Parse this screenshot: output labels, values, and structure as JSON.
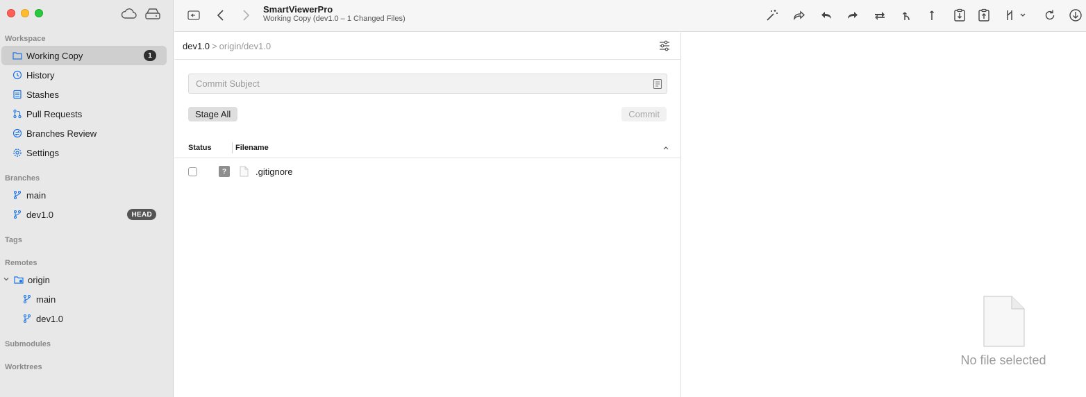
{
  "window": {
    "title": "SmartViewerPro",
    "subtitle": "Working Copy (dev1.0 – 1 Changed Files)"
  },
  "sidebar": {
    "workspace_title": "Workspace",
    "workspace_items": [
      {
        "label": "Working Copy",
        "icon": "folder-icon",
        "badge": "1",
        "selected": true
      },
      {
        "label": "History",
        "icon": "history-icon"
      },
      {
        "label": "Stashes",
        "icon": "stash-icon"
      },
      {
        "label": "Pull Requests",
        "icon": "pull-request-icon"
      },
      {
        "label": "Branches Review",
        "icon": "branches-review-icon"
      },
      {
        "label": "Settings",
        "icon": "gear-icon"
      }
    ],
    "branches_title": "Branches",
    "branches": [
      {
        "label": "main"
      },
      {
        "label": "dev1.0",
        "badge": "HEAD"
      }
    ],
    "tags_title": "Tags",
    "remotes_title": "Remotes",
    "remote": {
      "label": "origin",
      "branches": [
        "main",
        "dev1.0"
      ]
    },
    "submodules_title": "Submodules",
    "worktrees_title": "Worktrees"
  },
  "main": {
    "breadcrumb": {
      "local": "dev1.0",
      "separator": ">",
      "remote": "origin/dev1.0"
    },
    "commit_placeholder": "Commit Subject",
    "commit_value": "",
    "stage_all_label": "Stage All",
    "commit_label": "Commit",
    "columns": {
      "status": "Status",
      "filename": "Filename"
    },
    "files": [
      {
        "status_glyph": "?",
        "name": ".gitignore",
        "checked": false
      }
    ]
  },
  "detail": {
    "empty_text": "No file selected"
  },
  "colors": {
    "accent": "#1a73e8",
    "sidebar_bg": "#e8e8e8",
    "badge_bg": "#2f2f2f"
  }
}
